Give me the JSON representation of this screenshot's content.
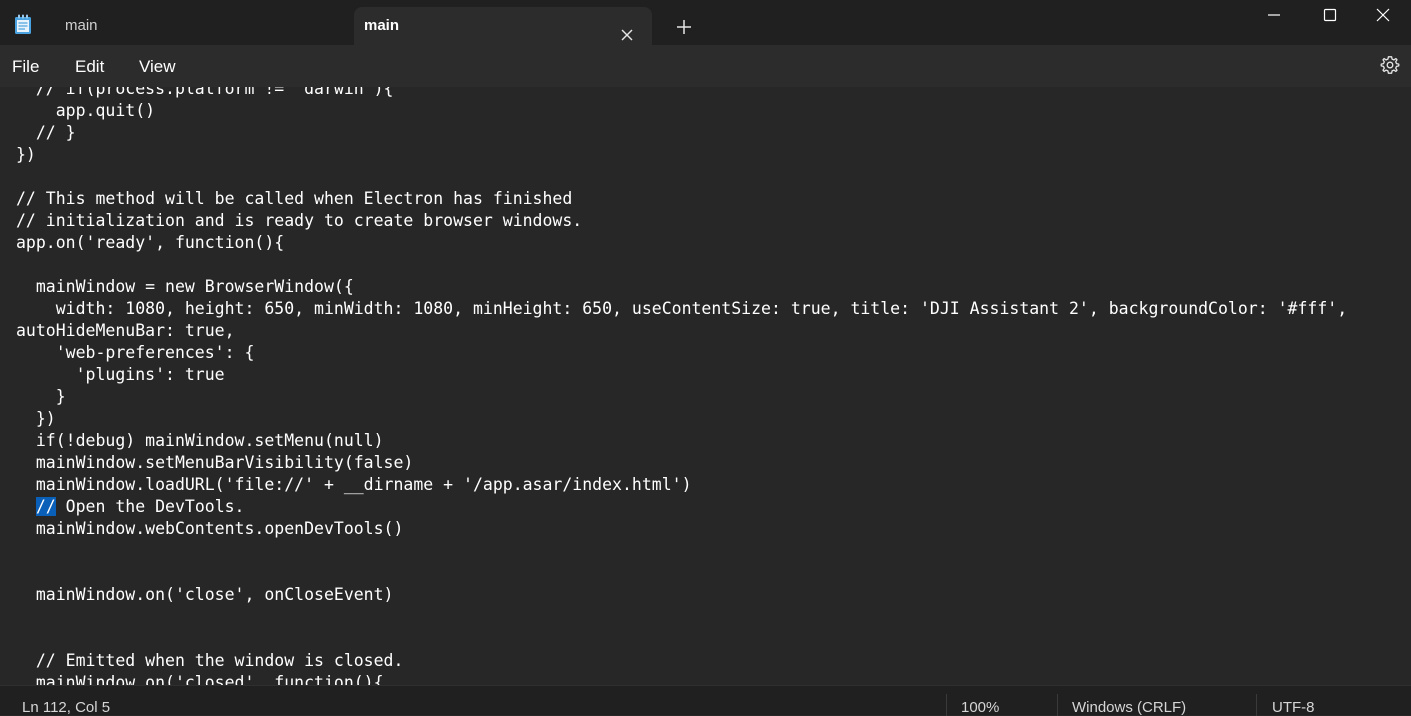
{
  "app": {
    "icon": "notepad-icon"
  },
  "tabs": [
    {
      "label": "main",
      "active": false
    },
    {
      "label": "main",
      "active": true
    }
  ],
  "window_controls": [
    "minimize-icon",
    "maximize-icon",
    "close-icon"
  ],
  "menu": {
    "items": [
      "File",
      "Edit",
      "View"
    ],
    "settings_icon": "gear-icon"
  },
  "editor": {
    "lines": [
      "  // if(process.platform != 'darwin'){",
      "    app.quit()",
      "  // }",
      "})",
      "",
      "// This method will be called when Electron has finished",
      "// initialization and is ready to create browser windows.",
      "app.on('ready', function(){",
      "",
      "  mainWindow = new BrowserWindow({",
      "    width: 1080, height: 650, minWidth: 1080, minHeight: 650, useContentSize: true, title: 'DJI Assistant 2', backgroundColor: '#fff',",
      "autoHideMenuBar: true,",
      "    'web-preferences': {",
      "      'plugins': true",
      "    }",
      "  })",
      "  if(!debug) mainWindow.setMenu(null)",
      "  mainWindow.setMenuBarVisibility(false)",
      "  mainWindow.loadURL('file://' + __dirname + '/app.asar/index.html')",
      "  // Open the DevTools.",
      "  mainWindow.webContents.openDevTools()",
      "",
      "",
      "  mainWindow.on('close', onCloseEvent)",
      "",
      "",
      "  // Emitted when the window is closed.",
      "  mainWindow.on('closed', function(){"
    ],
    "selection": {
      "line": 19,
      "text": "//"
    }
  },
  "status": {
    "position": "Ln 112, Col 5",
    "zoom": "100%",
    "line_ending": "Windows (CRLF)",
    "encoding": "UTF-8"
  }
}
